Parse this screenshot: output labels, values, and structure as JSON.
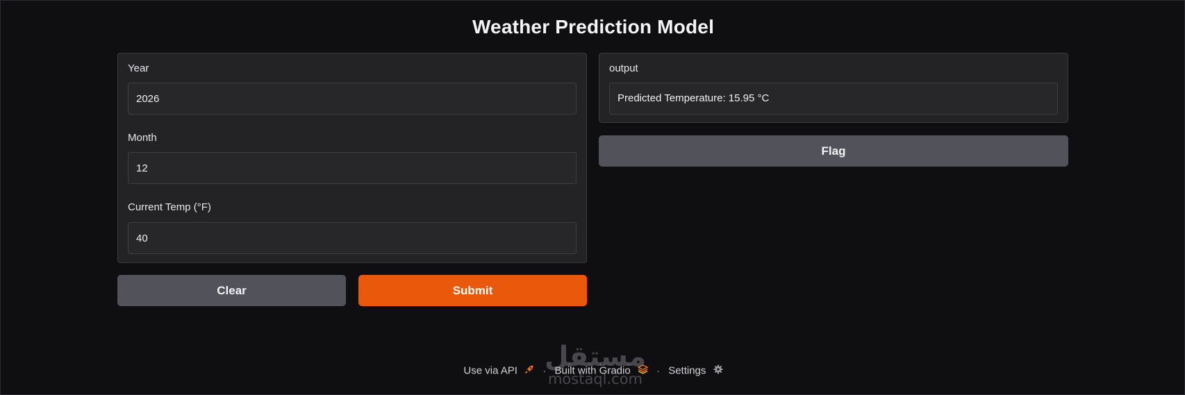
{
  "app": {
    "title": "Weather Prediction Model"
  },
  "inputs": {
    "year": {
      "label": "Year",
      "value": "2026"
    },
    "month": {
      "label": "Month",
      "value": "12"
    },
    "current_temp": {
      "label": "Current Temp (°F)",
      "value": "40"
    }
  },
  "actions": {
    "clear_label": "Clear",
    "submit_label": "Submit",
    "flag_label": "Flag"
  },
  "output": {
    "label": "output",
    "value": "Predicted Temperature: 15.95 °C"
  },
  "footer": {
    "api_label": "Use via API",
    "api_icon": "rocket-icon",
    "separator": "·",
    "built_label": "Built with Gradio",
    "built_icon": "gradio-logo-icon",
    "settings_label": "Settings",
    "settings_icon": "gear-icon"
  },
  "watermark": {
    "arabic": "مستقل",
    "latin": "mostaql.com"
  },
  "colors": {
    "background": "#0f0f12",
    "panel": "#232326",
    "primary": "#ea580c",
    "secondary": "#52525b"
  }
}
